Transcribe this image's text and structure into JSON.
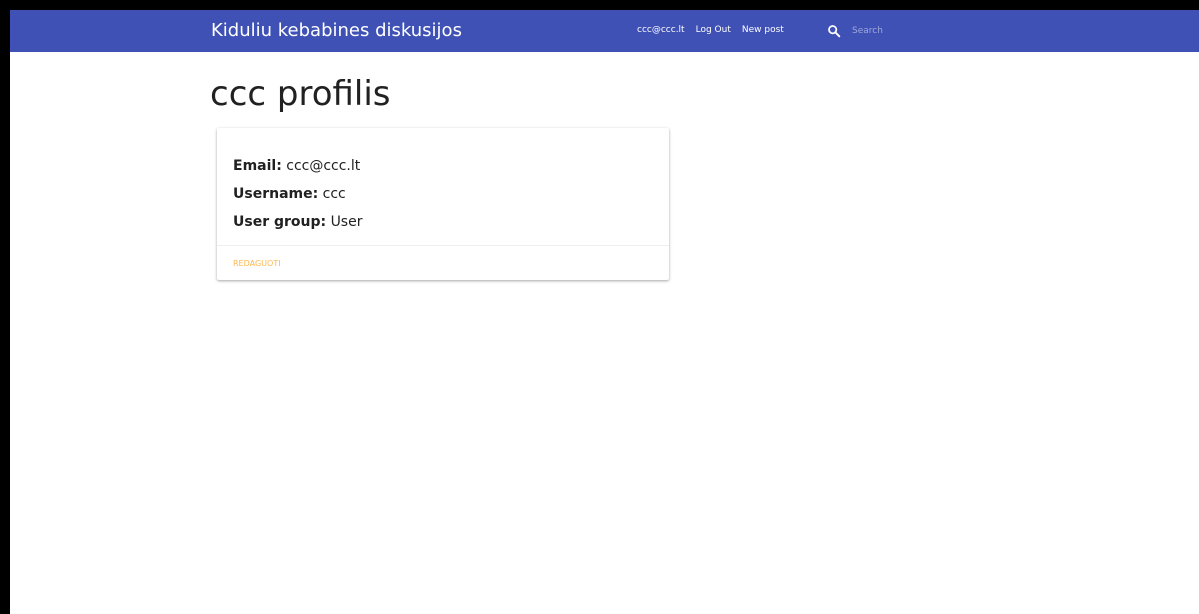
{
  "navbar": {
    "brand": "Kiduliu kebabines diskusijos",
    "links": {
      "user_email": "ccc@ccc.lt",
      "logout": "Log Out",
      "new_post": "New post"
    },
    "search": {
      "icon": "search-icon",
      "placeholder": "Search",
      "value": ""
    },
    "color": "#3f51b5"
  },
  "page": {
    "title": "ccc profilis"
  },
  "profile_card": {
    "email_label": "Email:",
    "email_value": "ccc@ccc.lt",
    "username_label": "Username:",
    "username_value": "ccc",
    "user_group_label": "User group:",
    "user_group_value": "User",
    "edit_action": "REDAGUOTI",
    "action_color": "#ffb74d"
  }
}
